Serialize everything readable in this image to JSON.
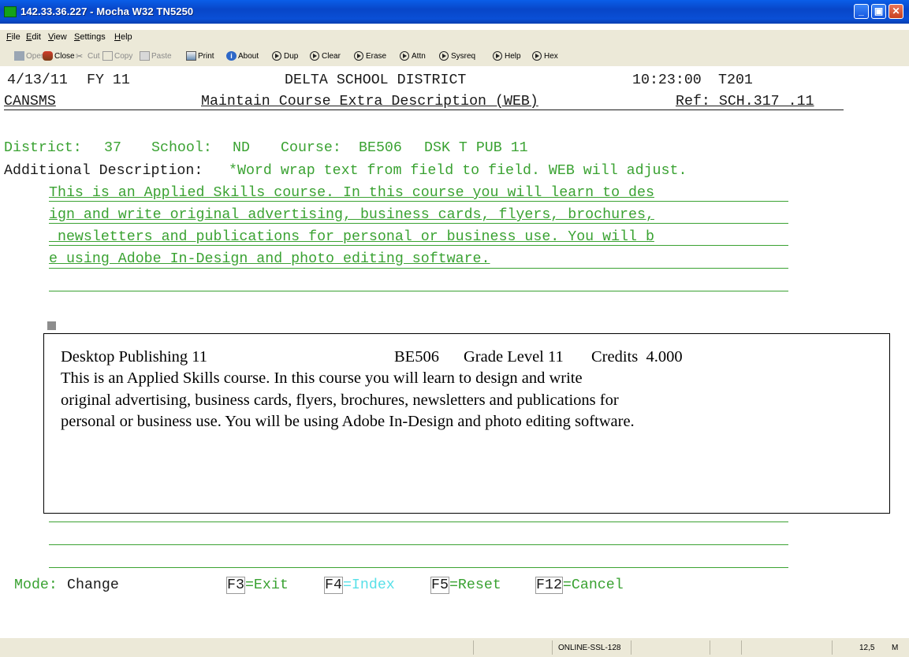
{
  "window": {
    "title": "142.33.36.227 - Mocha W32 TN5250"
  },
  "menu": [
    "File",
    "Edit",
    "View",
    "Settings",
    "Help"
  ],
  "toolbar": {
    "open": "Open",
    "close": "Close",
    "cut": "Cut",
    "copy": "Copy",
    "paste": "Paste",
    "print": "Print",
    "about": "About",
    "dup": "Dup",
    "clear": "Clear",
    "erase": "Erase",
    "attn": "Attn",
    "sysreq": "Sysreq",
    "help": "Help",
    "hex": "Hex"
  },
  "screen": {
    "date": "4/13/11",
    "fy": "FY 11",
    "district_name": "DELTA SCHOOL DISTRICT",
    "time": "10:23:00",
    "terminal_id": "T201",
    "program": "CANSMS",
    "screen_title": "Maintain Course Extra Description (WEB)",
    "ref": "Ref: SCH.317 .11",
    "district_label": "District:",
    "district_value": "37",
    "school_label": "School:",
    "school_value": "ND",
    "course_label": "Course:",
    "course_value": "BE506",
    "course_name": "DSK T PUB 11",
    "additional_label": "Additional Description:",
    "additional_note": "*Word wrap text from field to field. WEB will adjust.",
    "desc_lines": [
      "This is an Applied Skills course. In this course you will learn to des",
      "ign and write original advertising, business cards, flyers, brochures,",
      " newsletters and publications for personal or business use. You will b",
      "e using Adobe In-Design and photo editing software."
    ],
    "mode_label": "Mode:",
    "mode_value": "Change",
    "fkeys": {
      "f3": "F3",
      "f3_text": "=Exit",
      "f4": "F4",
      "f4_text": "=Index",
      "f5": "F5",
      "f5_text": "=Reset",
      "f12": "F12",
      "f12_text": "=Cancel"
    }
  },
  "preview": {
    "course_title": "Desktop Publishing 11",
    "course_code": "BE506",
    "grade": "Grade Level 11",
    "credits": "Credits  4.000",
    "body_lines": [
      "This is an Applied Skills course. In this course you will learn to design and write",
      "original advertising, business cards, flyers, brochures, newsletters and publications for",
      "personal or business use. You will be using Adobe In-Design and photo editing software."
    ]
  },
  "status": {
    "connection": "ONLINE-SSL-128",
    "cursor_pos": "12,5",
    "mode_indicator": "M"
  },
  "colors": {
    "field_green": "#3aa232",
    "highlight_cyan": "#58e0e8",
    "titlebar_blue": "#0846c8"
  }
}
